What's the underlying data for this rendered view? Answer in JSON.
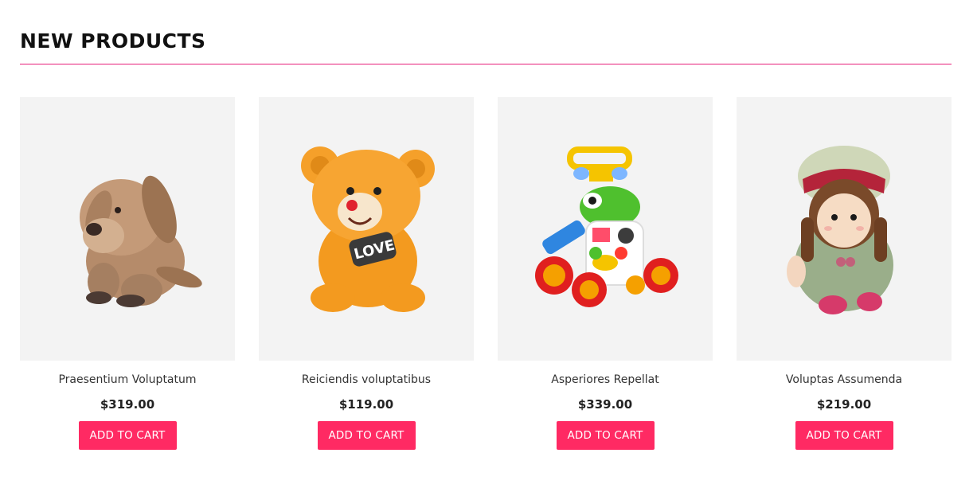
{
  "section": {
    "title": "NEW PRODUCTS"
  },
  "products": [
    {
      "image": "plush-dog-image",
      "name": "Praesentium Voluptatum",
      "price": "$319.00",
      "button": "ADD TO CART"
    },
    {
      "image": "teddy-bear-image",
      "name": "Reiciendis voluptatibus",
      "price": "$119.00",
      "button": "ADD TO CART"
    },
    {
      "image": "baby-walker-image",
      "name": "Asperiores Repellat",
      "price": "$339.00",
      "button": "ADD TO CART"
    },
    {
      "image": "rag-doll-image",
      "name": "Voluptas Assumenda",
      "price": "$219.00",
      "button": "ADD TO CART"
    }
  ],
  "colors": {
    "accent": "#ff2a63",
    "rule": "#e61e7a",
    "image_bg": "#f3f3f3"
  }
}
